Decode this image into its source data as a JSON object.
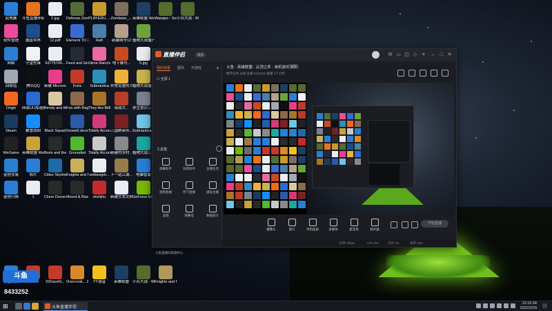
{
  "desktop_icons": [
    {
      "label": "此电脑",
      "color": "#2a7fd4"
    },
    {
      "label": "斗鱼直播伴侣",
      "color": "#e8731f"
    },
    {
      "label": "2.jpg",
      "color": "#e9edf2"
    },
    {
      "label": "Defense Zone 3 Ult...",
      "color": "#556b3a"
    },
    {
      "label": "PLAYERU... BATTLEGR...",
      "color": "#c99a2e"
    },
    {
      "label": "Zombster_...",
      "color": "#7d6f5d"
    },
    {
      "label": "英雄联盟 WeGame版",
      "color": "#1d3f62"
    },
    {
      "label": "Warpips - Soundtrack",
      "color": "#556b2f"
    },
    {
      "label": "小兵大战 - Warpips...",
      "color": "#556b2f"
    },
    {
      "label": "软件管理",
      "color": "#ec4b9a"
    },
    {
      "label": "魔兽世界",
      "color": "#1a4e8c"
    },
    {
      "label": "12.pdf",
      "color": "#e9edf2"
    },
    {
      "label": "Element TD 2",
      "color": "#3a6bd2"
    },
    {
      "label": "Raft",
      "color": "#4a7fa8"
    },
    {
      "label": "新建纯号12",
      "color": "#b5a08a"
    },
    {
      "label": "植物大战僵尸 2010年度版",
      "color": "#6ba43a"
    },
    {
      "label": "网络",
      "color": "#2a7fd4"
    },
    {
      "label": "守望先锋",
      "color": "#f0f3f6"
    },
    {
      "label": "63775700...",
      "color": "#e9edf2"
    },
    {
      "label": "Feed and Grow Fish",
      "color": "#262a33"
    },
    {
      "label": "Slime Rancher",
      "color": "#e96aa0"
    },
    {
      "label": "地下城与...",
      "color": "#c84a1f"
    },
    {
      "label": "5.jpg",
      "color": "#e9edf2"
    },
    {
      "label": "回收站",
      "color": "#a0a8b4"
    },
    {
      "label": "腾讯QQ",
      "color": "#111"
    },
    {
      "label": "新建 Microsoft ...",
      "color": "#e73e8b"
    },
    {
      "label": "Forts",
      "color": "#c23b28"
    },
    {
      "label": "Subnautica",
      "color": "#2e8fb8"
    },
    {
      "label": "异常受虐的 DEEEER S...",
      "color": "#f0b13a"
    },
    {
      "label": "植物大战僵尸 杂交版",
      "color": "#c9b34a"
    },
    {
      "label": "Origin",
      "color": "#f26822"
    },
    {
      "label": "网易UU加速器",
      "color": "#2a6cd0"
    },
    {
      "label": "Bendy and the Ink ...",
      "color": "#d9c9a3"
    },
    {
      "label": "Fun with Ragdoll...",
      "color": "#8a6a4a"
    },
    {
      "label": "They Are Billions",
      "color": "#a8742a"
    },
    {
      "label": "海战大...",
      "color": "#b83d2a"
    },
    {
      "label": "求生意识三 击杀",
      "color": "#7a8290"
    },
    {
      "label": "Steam",
      "color": "#1b3b5e"
    },
    {
      "label": "暴雪战网",
      "color": "#148eff"
    },
    {
      "label": "Black Squad",
      "color": "#222"
    },
    {
      "label": "fosww6.docx",
      "color": "#2b5aa8"
    },
    {
      "label": "Totally Accurat...",
      "color": "#d23a7a"
    },
    {
      "label": "三国群英传...",
      "color": "#7a2222"
    },
    {
      "label": "Subnautica Below Zero",
      "color": "#6ec6e6"
    },
    {
      "label": "WeGame",
      "color": "#222"
    },
    {
      "label": "英雄联盟 WeGame版",
      "color": "#c9a33a"
    },
    {
      "label": "Boris and the Dar...",
      "color": "#2a2a2a"
    },
    {
      "label": "Grounded",
      "color": "#52b82e"
    },
    {
      "label": "Totally Accurate ...",
      "color": "#c8c8c8"
    },
    {
      "label": "新建的水村 ...",
      "color": "#8a8a8a"
    },
    {
      "label": "植物大战三 2042",
      "color": "#1aa8a0"
    },
    {
      "label": "金信交易",
      "color": "#2a7fd4"
    },
    {
      "label": "照片",
      "color": "#2a7fd4"
    },
    {
      "label": "Cities Skylines",
      "color": "#1f6aa8"
    },
    {
      "label": "Knights and Merchants",
      "color": "#c8b05a"
    },
    {
      "label": "webwxget...",
      "color": "#e9edf2"
    },
    {
      "label": "下一站江湖...",
      "color": "#9a7a4a"
    },
    {
      "label": "电脑管家",
      "color": "#2a7fd4"
    },
    {
      "label": "金信行情",
      "color": "#2a7fd4"
    },
    {
      "label": "1",
      "color": "#e9edf2"
    },
    {
      "label": "Clone Drone in t...",
      "color": "#2a2a2a"
    },
    {
      "label": "Mount & Blade II ...",
      "color": "#2a2a2a"
    },
    {
      "label": "xkxhjhu",
      "color": "#c42a2a"
    },
    {
      "label": "新建文本文档.txt",
      "color": "#e9edf2"
    },
    {
      "label": "GeForce Experience",
      "color": "#76b900"
    },
    {
      "label": "Diplomacy is Not a...",
      "color": "#6a6a6a"
    },
    {
      "label": "暴雪战网",
      "color": "#2a7fd4"
    },
    {
      "label": "DDnet",
      "color": "#c43a2a"
    },
    {
      "label": "DDraceN...",
      "color": "#c43a2a"
    },
    {
      "label": "Overcook... 2",
      "color": "#d9892a"
    },
    {
      "label": "YY语音",
      "color": "#f2c21a"
    },
    {
      "label": "英雄联盟",
      "color": "#1d3f62"
    },
    {
      "label": "小兵大战 - Warpips",
      "color": "#556b2f"
    },
    {
      "label": "Knights and Merchants...",
      "color": "#b09a5a"
    }
  ],
  "watermark": {
    "logo": "斗鱼",
    "room_id": "8433252"
  },
  "taskbar": {
    "app_label": "斗鱼直播伴侣",
    "time": "12:15:34",
    "date": "2022/3/29"
  },
  "app": {
    "logo_text": "直播伴侣",
    "badge": "状态",
    "left_tabs": [
      "我的场景",
      "图块",
      "可游戏"
    ],
    "scene_label": "全屏 1",
    "tools_header": "工具箱",
    "tools": [
      {
        "label": "弹幕助手",
        "icon": "danmu-icon"
      },
      {
        "label": "背景助手",
        "icon": "background-icon"
      },
      {
        "label": "主播任务",
        "icon": "task-icon"
      },
      {
        "label": "视频直播",
        "icon": "video-icon"
      },
      {
        "label": "停下直播",
        "icon": "stop-icon"
      },
      {
        "label": "虚拟主播",
        "icon": "avatar-icon"
      },
      {
        "label": "滤镜",
        "icon": "filter-icon"
      },
      {
        "label": "弹幕墙",
        "icon": "wall-icon"
      },
      {
        "label": "数据统计",
        "icon": "stats-icon"
      }
    ],
    "footer": "斗鱼直播间助理中心",
    "stream_title": "斗鱼 - 英雄联盟 - 云顶之弈 - 单机游戏",
    "edit_label": "编辑",
    "sub_info": "数字证书   分辨   主播   8433252   直播   1个小时",
    "bottom": [
      {
        "label": "摄像头",
        "icon": "camera-icon"
      },
      {
        "label": "窗口",
        "icon": "window-icon"
      },
      {
        "label": "手机投屏",
        "icon": "phone-icon"
      },
      {
        "label": "多媒体",
        "icon": "media-icon"
      },
      {
        "label": "麦克风",
        "icon": "mic-icon"
      },
      {
        "label": "扬声器",
        "icon": "speaker-icon"
      }
    ],
    "go_live": "开始直播",
    "status": [
      "码率 0kbps",
      "CPU 0%",
      "内存 0%",
      "帧率 0fps"
    ]
  }
}
